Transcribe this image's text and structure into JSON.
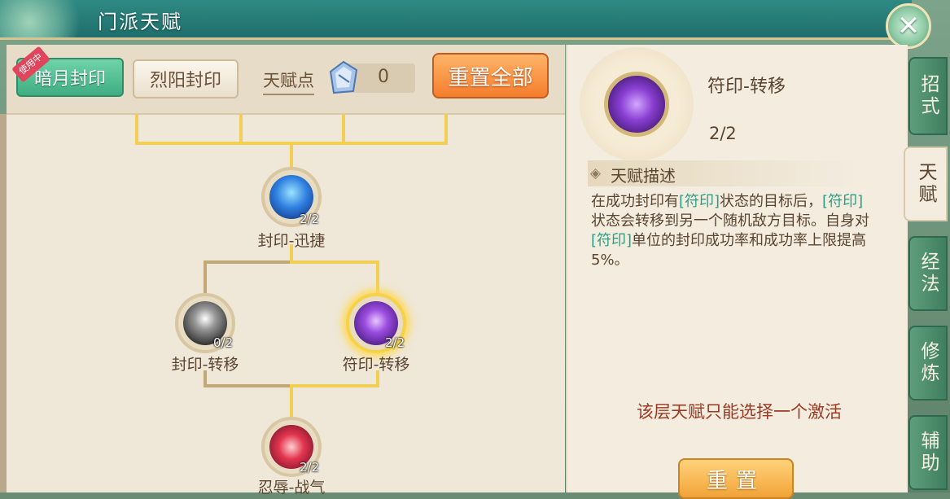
{
  "window": {
    "title": "门派天赋"
  },
  "toolbar": {
    "tab_active": "暗月封印",
    "tab_active_badge": "使用中",
    "tab_inactive": "烈阳封印",
    "points_label": "天赋点",
    "points_value": "0",
    "reset_all": "重置全部"
  },
  "tree": {
    "nodes": [
      {
        "label": "封印-迅捷",
        "count": "2/2",
        "icon": "blue-spirit-icon"
      },
      {
        "label": "封印-转移",
        "count": "0/2",
        "icon": "silver-orb-icon"
      },
      {
        "label": "符印-转移",
        "count": "2/2",
        "icon": "purple-knot-icon"
      },
      {
        "label": "忍辱-战气",
        "count": "2/2",
        "icon": "red-flame-icon"
      }
    ]
  },
  "detail": {
    "name": "符印-转移",
    "level": "2/2",
    "desc_title": "天赋描述",
    "desc_parts": [
      "在成功封印有",
      "[符印]",
      "状态的目标后，",
      "[符印]",
      "状态会转移到另一个随机敌方目标。自身对",
      "[符印]",
      "单位的封印成功率和成功率上限提高5%。"
    ],
    "notice": "该层天赋只能选择一个激活",
    "reset": "重置"
  },
  "side_tabs": [
    "招式",
    "天赋",
    "经法",
    "修炼",
    "辅助"
  ],
  "colors": {
    "accent_green": "#3fae82",
    "accent_orange": "#f47d2d",
    "highlight_text": "#2b9f86",
    "notice_text": "#9a3a22",
    "active_line": "#f2cf52"
  }
}
